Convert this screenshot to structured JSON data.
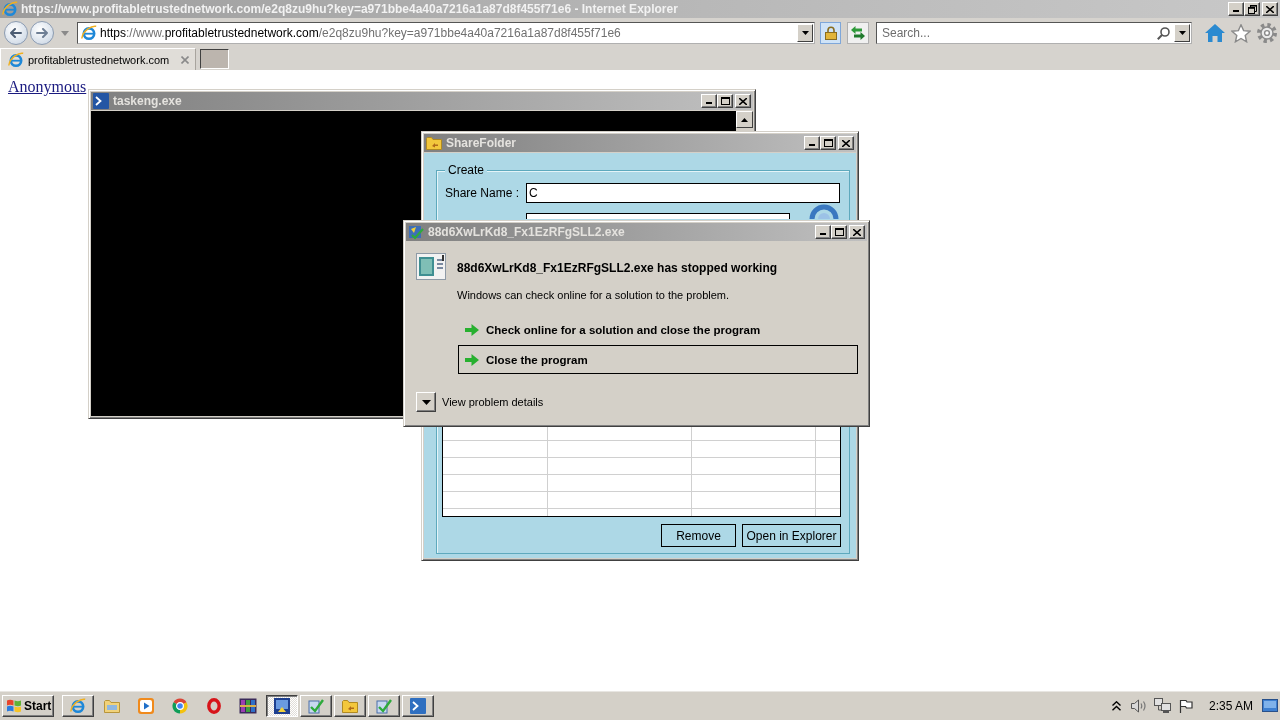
{
  "browser": {
    "title": "https://www.profitabletrustednetwork.com/e2q8zu9hu?key=a971bbe4a40a7216a1a87d8f455f71e6 - Internet Explorer"
  },
  "address_bar": {
    "url": "**https**://www.**profitabletrustednetwork.com**/e2q8zu9hu?key=a971bbe4a40a7216a1a87d8f455f71e6"
  },
  "search": {
    "placeholder": "Search..."
  },
  "tabs": [
    {
      "label": "profitabletrustednetwork.com",
      "selected": true
    }
  ],
  "page": {
    "link": "Anonymous"
  },
  "console_window": {
    "title": "taskeng.exe"
  },
  "share_folder": {
    "title": "ShareFolder",
    "group_label": "Create",
    "share_name": {
      "label": "Share Name :",
      "value": "C"
    },
    "buttons": [
      "Remove",
      "Open in Explorer"
    ]
  },
  "error_dialog": {
    "title": "88d6XwLrKd8_Fx1EzRFgSLL2.exe",
    "heading": "88d6XwLrKd8_Fx1EzRFgSLL2.exe has stopped working",
    "message": "Windows can check online for a solution to the problem.",
    "options": [
      {
        "label": "Check online for a solution and close the program",
        "selected": false
      },
      {
        "label": "Close the program",
        "selected": true
      }
    ],
    "details": {
      "label": "View problem details",
      "expanded": false
    }
  },
  "taskbar": {
    "start": "Start",
    "items": [
      {
        "kind": "browser",
        "running": true,
        "selected": false
      },
      {
        "kind": "files",
        "running": false,
        "selected": false
      },
      {
        "kind": "player",
        "running": false,
        "selected": false
      },
      {
        "kind": "web",
        "running": false,
        "selected": false
      },
      {
        "kind": "ring",
        "running": false,
        "selected": false
      },
      {
        "kind": "archive",
        "running": false,
        "selected": false
      },
      {
        "kind": "program",
        "running": true,
        "selected": true
      },
      {
        "kind": "setup",
        "running": true,
        "selected": false
      },
      {
        "kind": "folder_app",
        "running": true,
        "selected": false
      },
      {
        "kind": "setup",
        "running": true,
        "selected": false
      },
      {
        "kind": "console",
        "running": true,
        "selected": false
      }
    ],
    "clock": "2:35 AM"
  }
}
